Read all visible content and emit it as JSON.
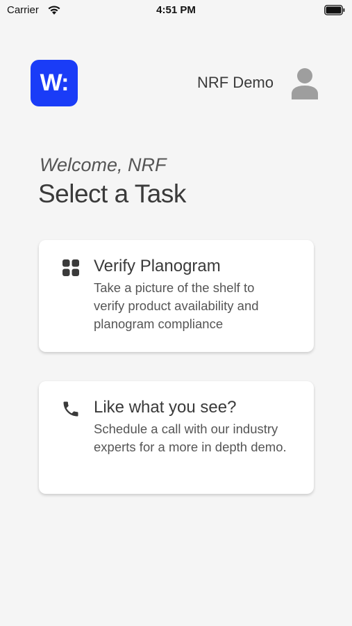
{
  "status_bar": {
    "carrier": "Carrier",
    "time": "4:51 PM"
  },
  "header": {
    "logo_text": "W:",
    "user_name": "NRF Demo"
  },
  "welcome": "Welcome, NRF",
  "title": "Select a Task",
  "tasks": [
    {
      "icon": "grid-icon",
      "title": "Verify Planogram",
      "description": "Take a picture of the shelf to verify product availability and planogram compliance"
    },
    {
      "icon": "phone-icon",
      "title": "Like what you see?",
      "description": "Schedule a call with our industry experts for a more in depth demo."
    }
  ],
  "colors": {
    "background": "#f5f5f5",
    "brand": "#1a3cf7",
    "text": "#3a3a3a",
    "avatar": "#9e9e9e"
  }
}
